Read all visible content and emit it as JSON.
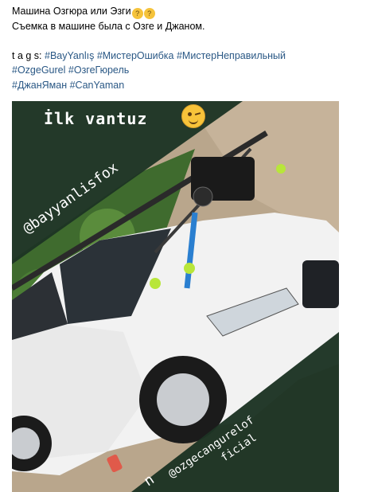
{
  "post": {
    "title": "Машина Озгюра или Эзги",
    "title_emoji": [
      "thinking-face-emoji",
      "thinking-face-emoji"
    ],
    "subtitle": "Съемка в машине была с Озге и Джаном.",
    "tags_label": "t a g s:",
    "tags_line1": [
      "#BayYanlış",
      "#МистерОшибка",
      "#МистерНеправильный"
    ],
    "tags_line2": [
      "#OzgeGurel",
      "#ОзгеГюрель"
    ],
    "tags_line3": [
      "#ДжанЯман",
      "#CanYaman"
    ],
    "tag_color": "#2a5885"
  },
  "image": {
    "sticker_title": "İlk vantuz",
    "sticker_emoji": "winking-face-emoji",
    "handle_1": "@bayyanlisfox",
    "handle_2_part1": "@ozgecangurelof",
    "handle_2_part2": "ficial",
    "fragment": "n",
    "description_colors": {
      "car": "#f2f2f2",
      "sticker_band": "#1e3a26",
      "mount_strap": "#2a7fd0",
      "ball": "#b8e63a"
    }
  }
}
